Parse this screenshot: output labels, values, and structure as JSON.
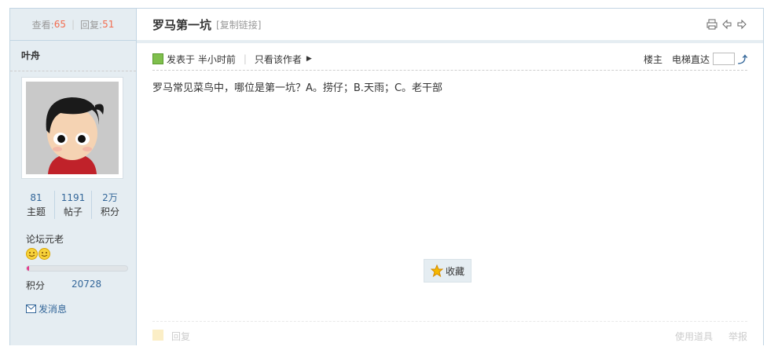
{
  "stats_header": {
    "views_label": "查看:",
    "views": "65",
    "replies_label": "回复:",
    "replies": "51"
  },
  "author": {
    "name": "叶舟",
    "threads": "81",
    "threads_label": "主题",
    "posts": "1191",
    "posts_label": "帖子",
    "credits_short": "2万",
    "credits_label": "积分",
    "rank": "论坛元老",
    "progress": 0.02,
    "score_label": "积分",
    "score": "20728",
    "pm_label": "发消息"
  },
  "thread": {
    "title": "罗马第一坑",
    "copy_link": "[复制链接]",
    "posted": "发表于 半小时前",
    "only_author": "只看该作者",
    "floor": "楼主",
    "jump_label": "电梯直达",
    "content": "罗马常见菜鸟中，哪位是第一坑？A。捞仔；B.天雨；C。老干部",
    "fav_label": "收藏",
    "reply_label": "回复",
    "use_item": "使用道具",
    "report": "举报"
  },
  "colors": {
    "accent": "#f26c4f",
    "link": "#336699",
    "panel": "#e5edf2",
    "border": "#c2d5e3"
  }
}
